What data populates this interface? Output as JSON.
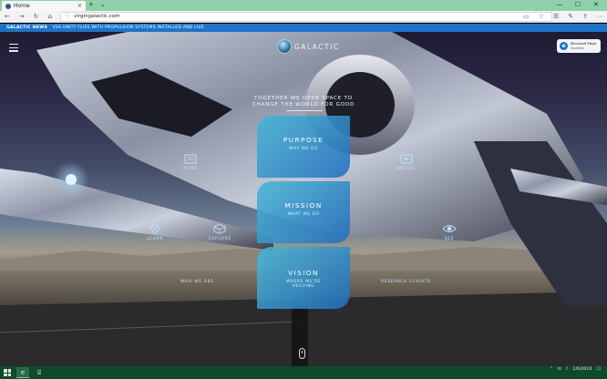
{
  "browser": {
    "tab_title": "Home",
    "tab_close": "×",
    "new_tab": "+",
    "tab_menu": "⌄",
    "window_controls": [
      "—",
      "☐",
      "✕"
    ],
    "nav": {
      "back": "←",
      "forward": "→",
      "refresh": "↻",
      "home": "⌂"
    },
    "url": "virgingalactic.com",
    "right_icons": [
      "▭",
      "☆",
      "☰",
      "✎",
      "⇪",
      "⋯"
    ]
  },
  "ticker": {
    "label": "GALACTIC NEWS",
    "text": "VSS UNITY FLIES WITH PROPULSION SYSTEMS INSTALLED AND LIVE"
  },
  "hero": {
    "logo_text": "GALACTIC",
    "edge_badge": {
      "line1": "Microsoft Edge",
      "line2": "inspires",
      "glyph": "e"
    },
    "tagline": "TOGETHER WE OPEN SPACE TO CHANGE THE WORLD FOR GOOD",
    "cards": {
      "purpose": {
        "title": "PURPOSE",
        "subtitle": "WHY WE GO"
      },
      "mission": {
        "title": "MISSION",
        "subtitle": "WHAT WE DO"
      },
      "vision": {
        "title": "VISION",
        "subtitle": "WHERE WE'RE HEADING"
      }
    },
    "links": {
      "news": "NEWS",
      "watch": "WATCH",
      "learn": "LEARN",
      "explore": "EXPLORE",
      "see": "SEE",
      "who_we_are": "WHO WE ARE",
      "research_flights": "RESEARCH FLIGHTS"
    }
  },
  "taskbar": {
    "apps": [
      "e",
      "⌸"
    ],
    "tray_icons": [
      "⌃",
      "⊡",
      "♪",
      "🗨"
    ],
    "time": "",
    "date": "2/6/2018"
  },
  "colors": {
    "ticker_bg": "#1f73c6",
    "card_accent": "#48b7d6",
    "taskbar_bg": "#0f4a2c",
    "tabbar_bg": "#8fd0a8"
  }
}
